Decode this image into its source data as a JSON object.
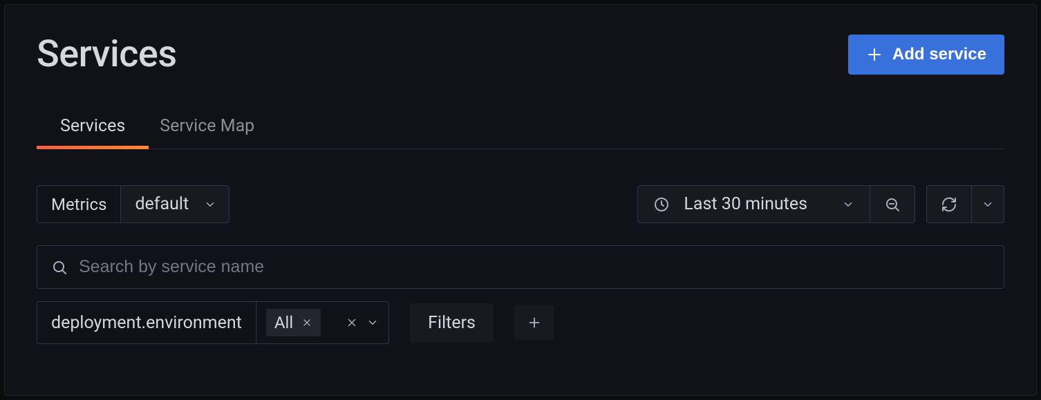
{
  "header": {
    "title": "Services",
    "add_button_label": "Add service"
  },
  "tabs": [
    {
      "label": "Services",
      "active": true
    },
    {
      "label": "Service Map",
      "active": false
    }
  ],
  "controls": {
    "metrics_label": "Metrics",
    "metrics_value": "default",
    "time_range": "Last 30 minutes"
  },
  "search": {
    "placeholder": "Search by service name",
    "value": ""
  },
  "filters": {
    "primary": {
      "key": "deployment.environment",
      "chip_value": "All"
    },
    "filters_button_label": "Filters"
  },
  "icons": {
    "plus": "plus",
    "chevron_down": "chevron-down",
    "clock": "clock",
    "zoom_out": "zoom-out",
    "refresh": "refresh",
    "search": "search",
    "close": "close"
  },
  "colors": {
    "accent_primary": "#3871dc",
    "tab_gradient_start": "#f55f3e",
    "tab_gradient_end": "#ff8833",
    "background": "#111217"
  }
}
